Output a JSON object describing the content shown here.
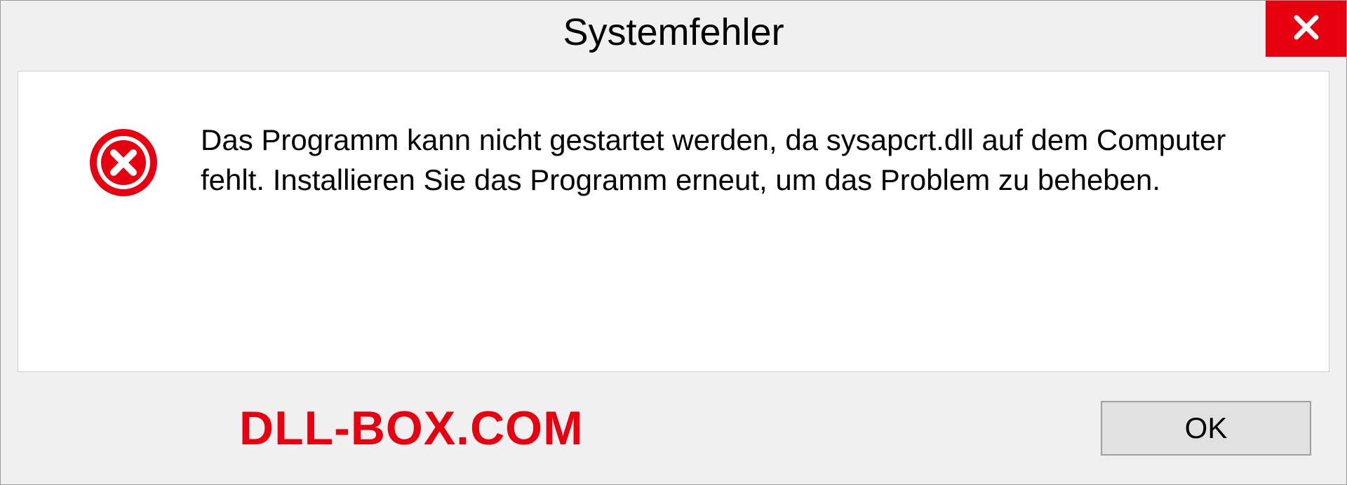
{
  "dialog": {
    "title": "Systemfehler",
    "message": "Das Programm kann nicht gestartet werden, da sysapcrt.dll auf dem Computer fehlt. Installieren Sie das Programm erneut, um das Problem zu beheben.",
    "ok_label": "OK"
  },
  "watermark": "DLL-BOX.COM"
}
